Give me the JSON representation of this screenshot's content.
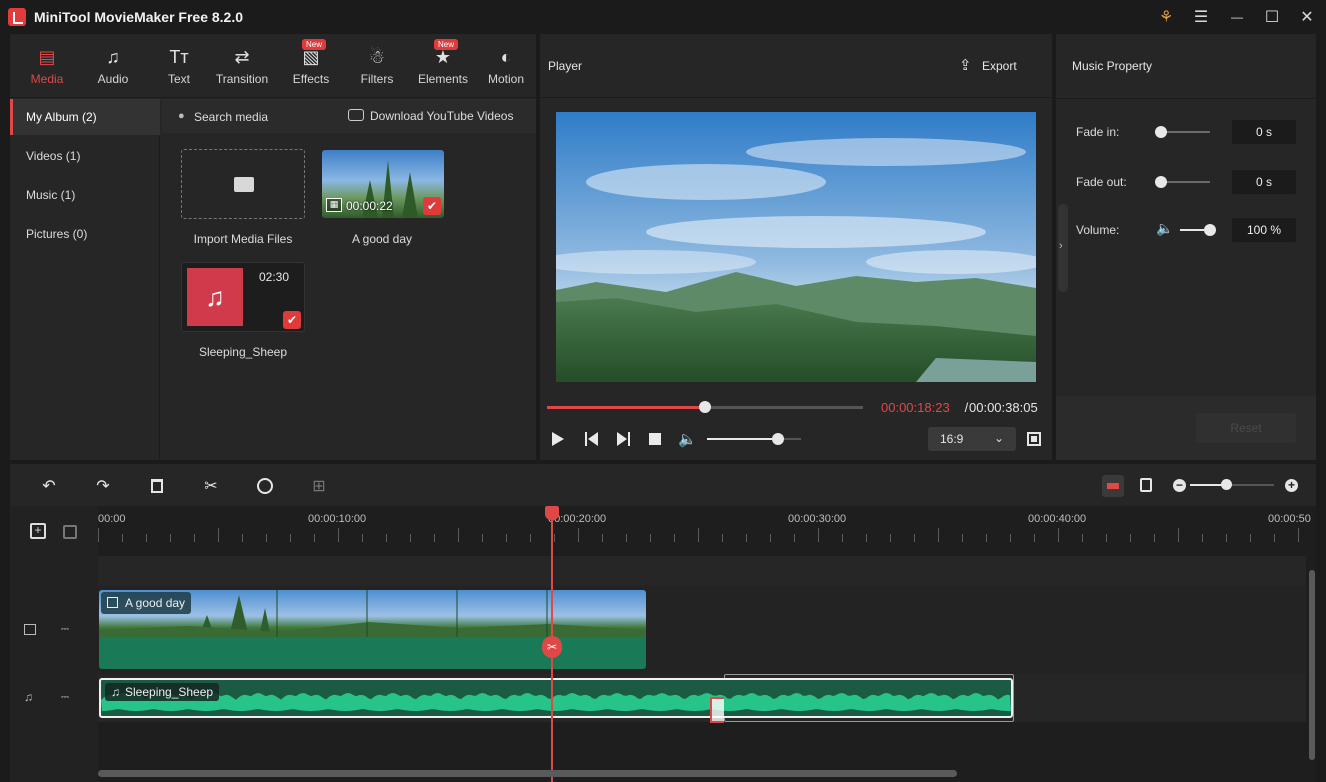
{
  "window": {
    "title": "MiniTool MovieMaker Free 8.2.0",
    "icons": [
      "key-icon",
      "menu-icon",
      "minimize-icon",
      "maximize-icon",
      "close-icon"
    ],
    "glyphs": {
      "key": "⚘",
      "menu": "☰",
      "minimize": "—",
      "maximize": "☐",
      "close": "✕"
    }
  },
  "main_tabs": [
    {
      "label": "Media",
      "icon": "▤",
      "active": true
    },
    {
      "label": "Audio",
      "icon": "♫"
    },
    {
      "label": "Text",
      "icon": "Tт"
    },
    {
      "label": "Transition",
      "icon": "⇄"
    },
    {
      "label": "Effects",
      "icon": "▧",
      "badge": "New"
    },
    {
      "label": "Filters",
      "icon": "☃"
    },
    {
      "label": "Elements",
      "icon": "★",
      "badge": "New"
    },
    {
      "label": "Motion",
      "icon": "◐"
    }
  ],
  "album": {
    "items": [
      "My Album (2)",
      "Videos (1)",
      "Music (1)",
      "Pictures (0)"
    ]
  },
  "media": {
    "search_placeholder": "Search media",
    "download_label": "Download YouTube Videos",
    "import_label": "Import Media Files",
    "items": [
      {
        "name": "A good day",
        "duration": "00:00:22"
      },
      {
        "name": "Sleeping_Sheep",
        "duration": "02:30"
      }
    ]
  },
  "player": {
    "title": "Player",
    "export_label": "Export",
    "current_time": "00:00:18:23",
    "separator": " / ",
    "total_time": "00:00:38:05",
    "progress": 0.5,
    "volume": 0.75,
    "aspect_ratio": "16:9"
  },
  "music_property": {
    "title": "Music Property",
    "fade_in_label": "Fade in:",
    "fade_in_value": "0 s",
    "fade_out_label": "Fade out:",
    "fade_out_value": "0 s",
    "volume_label": "Volume:",
    "volume_value": "100 %",
    "reset_label": "Reset"
  },
  "timeline": {
    "ruler": [
      "00:00",
      "00:00:10:00",
      "00:00:20:00",
      "00:00:30:00",
      "00:00:40:00",
      "00:00:50"
    ],
    "video_clip": "A good day",
    "audio_clip": "Sleeping_Sheep"
  },
  "colors": {
    "accent": "#e04848",
    "panel": "#262626",
    "clip_green": "#1a7f5a",
    "wave_green": "#27c48a"
  }
}
